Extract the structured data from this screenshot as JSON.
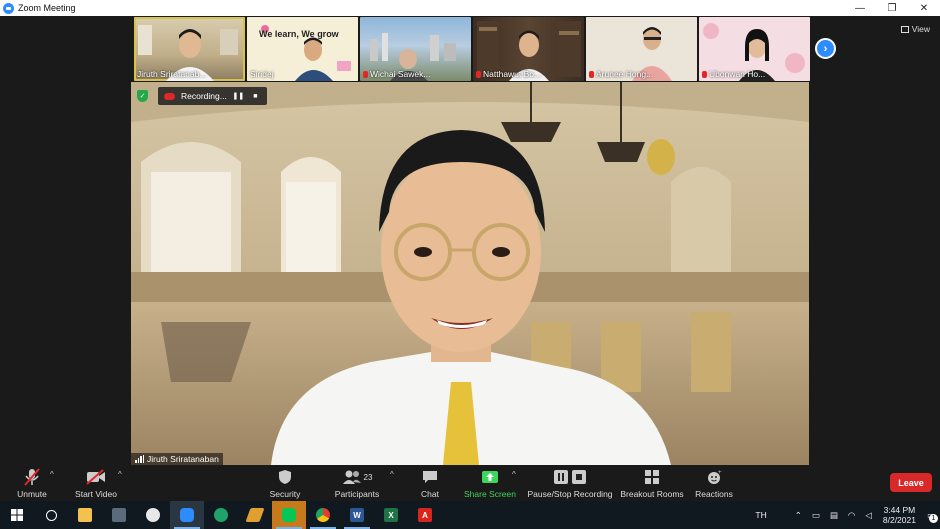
{
  "window": {
    "title": "Zoom Meeting",
    "minimize": "—",
    "maximize": "❐",
    "close": "✕"
  },
  "gallery": {
    "view_label": "View",
    "participants": [
      {
        "name": "Jiruth Sriratanab...",
        "muted": false,
        "active": true
      },
      {
        "name": "Siridej",
        "muted": false,
        "active": false,
        "banner": "We learn, We grow"
      },
      {
        "name": "Wichai Sawek...",
        "muted": true,
        "active": false
      },
      {
        "name": "Natthawut Bo...",
        "muted": true,
        "active": false
      },
      {
        "name": "Arunee Hong...",
        "muted": true,
        "active": false
      },
      {
        "name": "Ubonwan Ho...",
        "muted": true,
        "active": false
      }
    ]
  },
  "recording": {
    "label": "Recording..."
  },
  "speaker": {
    "name": "Jiruth Sriratanaban"
  },
  "toolbar": {
    "unmute": "Unmute",
    "start_video": "Start Video",
    "security": "Security",
    "participants": "Participants",
    "participants_count": "23",
    "chat": "Chat",
    "share_screen": "Share Screen",
    "pause_stop_recording": "Pause/Stop Recording",
    "breakout_rooms": "Breakout Rooms",
    "reactions": "Reactions",
    "leave": "Leave"
  },
  "taskbar": {
    "language": "TH",
    "time": "3:44 PM",
    "date": "8/2/2021",
    "notifications": "1"
  },
  "colors": {
    "accent": "#2d8cff",
    "leave": "#d92828",
    "share": "#3dd65c"
  }
}
